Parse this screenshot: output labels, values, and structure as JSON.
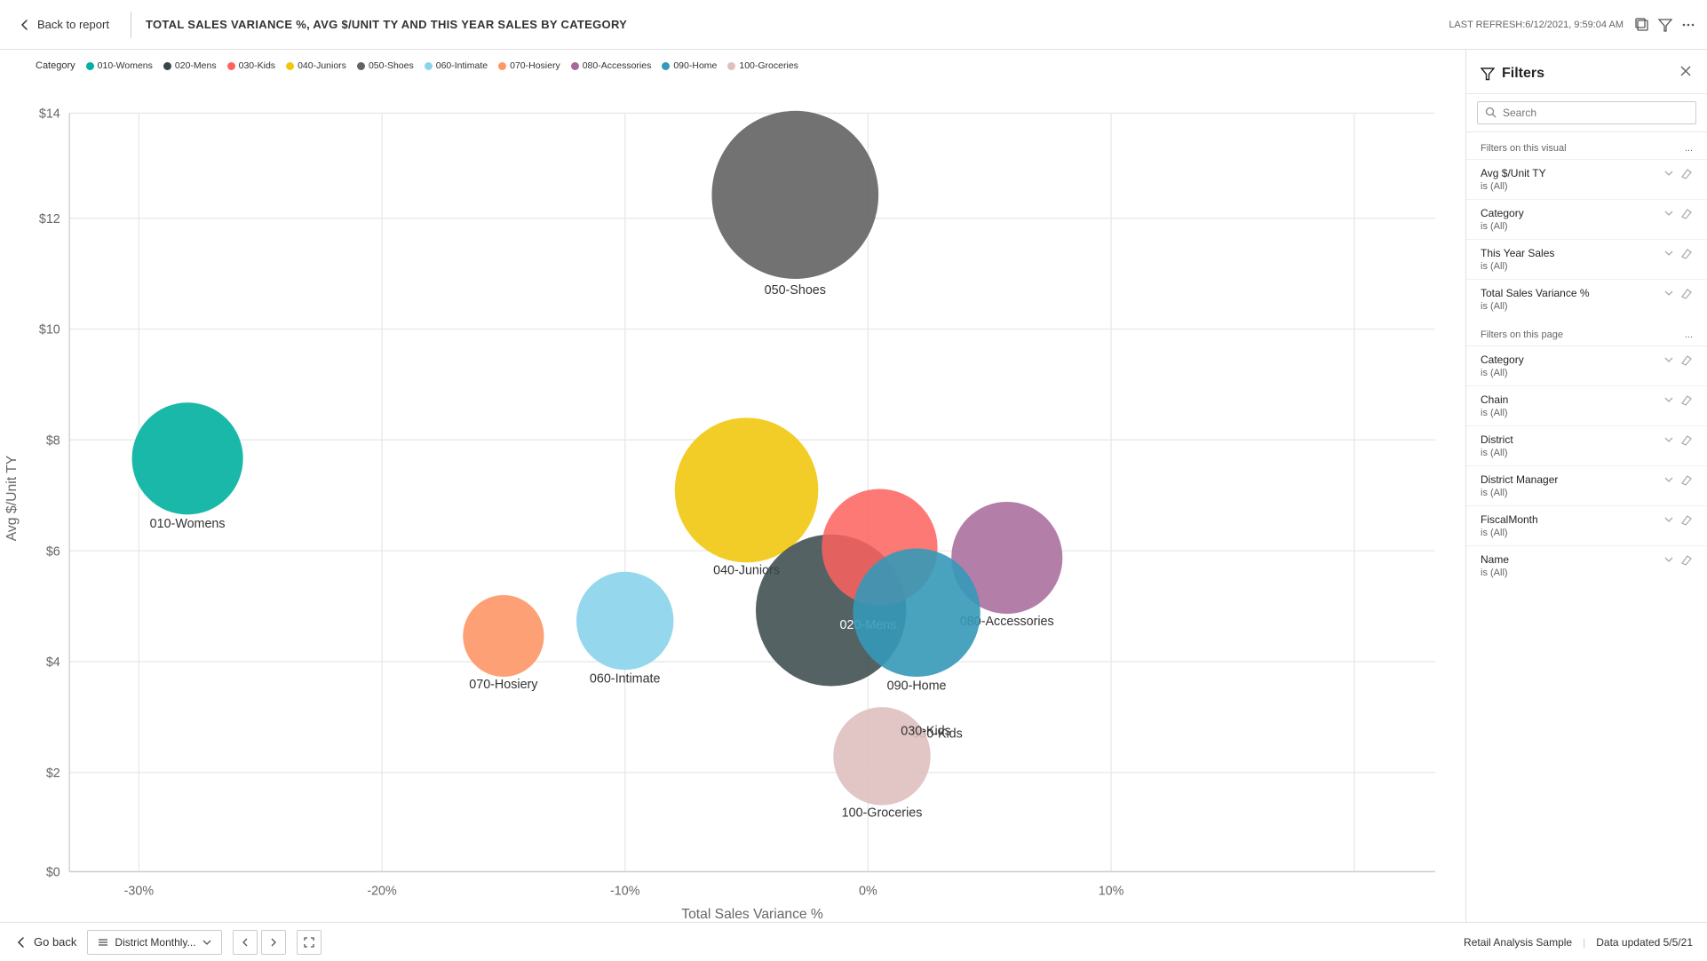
{
  "topbar": {
    "back_label": "Back to report",
    "chart_title": "TOTAL SALES VARIANCE %, AVG $/UNIT TY AND THIS YEAR SALES BY CATEGORY",
    "last_refresh": "LAST REFRESH:6/12/2021, 9:59:04 AM"
  },
  "legend": {
    "category_label": "Category",
    "items": [
      {
        "id": "010-Womens",
        "color": "#00B0A0"
      },
      {
        "id": "020-Mens",
        "color": "#374649"
      },
      {
        "id": "030-Kids",
        "color": "#FD625E"
      },
      {
        "id": "040-Juniors",
        "color": "#F2C80F"
      },
      {
        "id": "050-Shoes",
        "color": "#636363"
      },
      {
        "id": "060-Intimate",
        "color": "#8AD4EB"
      },
      {
        "id": "070-Hosiery",
        "color": "#FE9666"
      },
      {
        "id": "080-Accessories",
        "color": "#A66999"
      },
      {
        "id": "090-Home",
        "color": "#3599B8"
      },
      {
        "id": "100-Groceries",
        "color": "#DFBFBF"
      }
    ]
  },
  "chart": {
    "x_axis_label": "Total Sales Variance %",
    "y_axis_label": "Avg $/Unit TY",
    "x_ticks": [
      "-30%",
      "-20%",
      "-10%",
      "0%",
      "10%"
    ],
    "y_ticks": [
      "$0",
      "$2",
      "$4",
      "$6",
      "$8",
      "$10",
      "$12",
      "$14"
    ],
    "bubbles": [
      {
        "id": "010-Womens",
        "label": "010-Womens",
        "cx_pct": 4.5,
        "cy_pct": 47,
        "r": 48,
        "color": "#00B0A0"
      },
      {
        "id": "020-Mens",
        "label": "020-Mens",
        "cx_pct": 73.5,
        "cy_pct": 55,
        "r": 65,
        "color": "#FD625E"
      },
      {
        "id": "030-Kids",
        "label": "030-Kids",
        "cx_pct": 76.5,
        "cy_pct": 50,
        "r": 50,
        "color": "#374649"
      },
      {
        "id": "040-Juniors",
        "label": "040-Juniors",
        "cx_pct": 63.5,
        "cy_pct": 44,
        "r": 62,
        "color": "#F2C80F"
      },
      {
        "id": "050-Shoes",
        "label": "050-Shoes",
        "cx_pct": 68,
        "cy_pct": 5,
        "r": 72,
        "color": "#636363"
      },
      {
        "id": "060-Intimate",
        "label": "060-Intimate",
        "cx_pct": 51.5,
        "cy_pct": 60,
        "r": 42,
        "color": "#8AD4EB"
      },
      {
        "id": "070-Hosiery",
        "label": "070-Hosiery",
        "cx_pct": 41,
        "cy_pct": 63,
        "r": 35,
        "color": "#FE9666"
      },
      {
        "id": "080-Accessories",
        "label": "080-Accessories",
        "cx_pct": 89,
        "cy_pct": 49,
        "r": 48,
        "color": "#A66999"
      },
      {
        "id": "090-Home",
        "label": "090-Home",
        "cx_pct": 83,
        "cy_pct": 57,
        "r": 55,
        "color": "#3599B8"
      },
      {
        "id": "100-Groceries",
        "label": "100-Groceries",
        "cx_pct": 77.5,
        "cy_pct": 78,
        "r": 42,
        "color": "#DFBFBF"
      }
    ]
  },
  "filters": {
    "title": "Filters",
    "search_placeholder": "Search",
    "visual_section_label": "Filters on this visual",
    "visual_more": "...",
    "page_section_label": "Filters on this page",
    "page_more": "...",
    "visual_filters": [
      {
        "name": "Avg $/Unit TY",
        "value": "is (All)"
      },
      {
        "name": "Category",
        "value": "is (All)"
      },
      {
        "name": "This Year Sales",
        "value": "is (All)"
      },
      {
        "name": "Total Sales Variance %",
        "value": "is (All)"
      }
    ],
    "page_filters": [
      {
        "name": "Category",
        "value": "is (All)"
      },
      {
        "name": "Chain",
        "value": "is (All)"
      },
      {
        "name": "District",
        "value": "is (All)"
      },
      {
        "name": "District Manager",
        "value": "is (All)"
      },
      {
        "name": "FiscalMonth",
        "value": "is (All)"
      },
      {
        "name": "Name",
        "value": "is (All)"
      }
    ]
  },
  "bottombar": {
    "go_back_label": "Go back",
    "page_tab_label": "District Monthly...",
    "report_name": "Retail Analysis Sample",
    "data_updated": "Data updated 5/5/21"
  }
}
